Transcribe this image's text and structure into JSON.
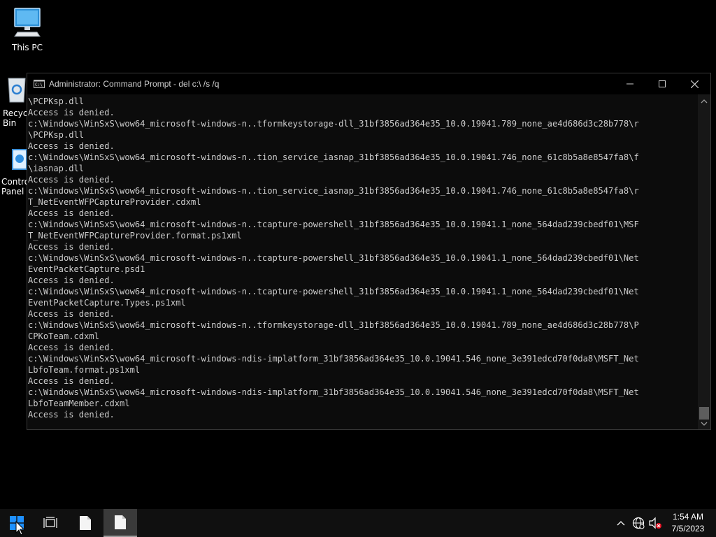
{
  "desktop": {
    "icons": [
      {
        "label": "This PC"
      },
      {
        "label": "Recycle Bin"
      },
      {
        "label": "Control Panel"
      }
    ]
  },
  "window": {
    "title": "Administrator: Command Prompt - del  c:\\ /s /q",
    "console_lines": [
      "\\PCPKsp.dll",
      "Access is denied.",
      "c:\\Windows\\WinSxS\\wow64_microsoft-windows-n..tformkeystorage-dll_31bf3856ad364e35_10.0.19041.789_none_ae4d686d3c28b778\\r",
      "\\PCPKsp.dll",
      "Access is denied.",
      "c:\\Windows\\WinSxS\\wow64_microsoft-windows-n..tion_service_iasnap_31bf3856ad364e35_10.0.19041.746_none_61c8b5a8e8547fa8\\f",
      "\\iasnap.dll",
      "Access is denied.",
      "c:\\Windows\\WinSxS\\wow64_microsoft-windows-n..tion_service_iasnap_31bf3856ad364e35_10.0.19041.746_none_61c8b5a8e8547fa8\\r",
      "T_NetEventWFPCaptureProvider.cdxml",
      "Access is denied.",
      "c:\\Windows\\WinSxS\\wow64_microsoft-windows-n..tcapture-powershell_31bf3856ad364e35_10.0.19041.1_none_564dad239cbedf01\\MSF",
      "T_NetEventWFPCaptureProvider.format.ps1xml",
      "Access is denied.",
      "c:\\Windows\\WinSxS\\wow64_microsoft-windows-n..tcapture-powershell_31bf3856ad364e35_10.0.19041.1_none_564dad239cbedf01\\Net",
      "EventPacketCapture.psd1",
      "Access is denied.",
      "c:\\Windows\\WinSxS\\wow64_microsoft-windows-n..tcapture-powershell_31bf3856ad364e35_10.0.19041.1_none_564dad239cbedf01\\Net",
      "EventPacketCapture.Types.ps1xml",
      "Access is denied.",
      "c:\\Windows\\WinSxS\\wow64_microsoft-windows-n..tformkeystorage-dll_31bf3856ad364e35_10.0.19041.789_none_ae4d686d3c28b778\\P",
      "CPKoTeam.cdxml",
      "Access is denied.",
      "c:\\Windows\\WinSxS\\wow64_microsoft-windows-ndis-implatform_31bf3856ad364e35_10.0.19041.546_none_3e391edcd70f0da8\\MSFT_Net",
      "LbfoTeam.format.ps1xml",
      "Access is denied.",
      "c:\\Windows\\WinSxS\\wow64_microsoft-windows-ndis-implatform_31bf3856ad364e35_10.0.19041.546_none_3e391edcd70f0da8\\MSFT_Net",
      "LbfoTeamMember.cdxml",
      "Access is denied."
    ]
  },
  "taskbar": {
    "clock_time": "1:54 AM",
    "clock_date": "7/5/2023"
  },
  "colors": {
    "console_bg": "#0c0c0c",
    "console_text": "#cccccc",
    "taskbar_bg": "#101010",
    "windows_blue": "#1e90ff"
  }
}
